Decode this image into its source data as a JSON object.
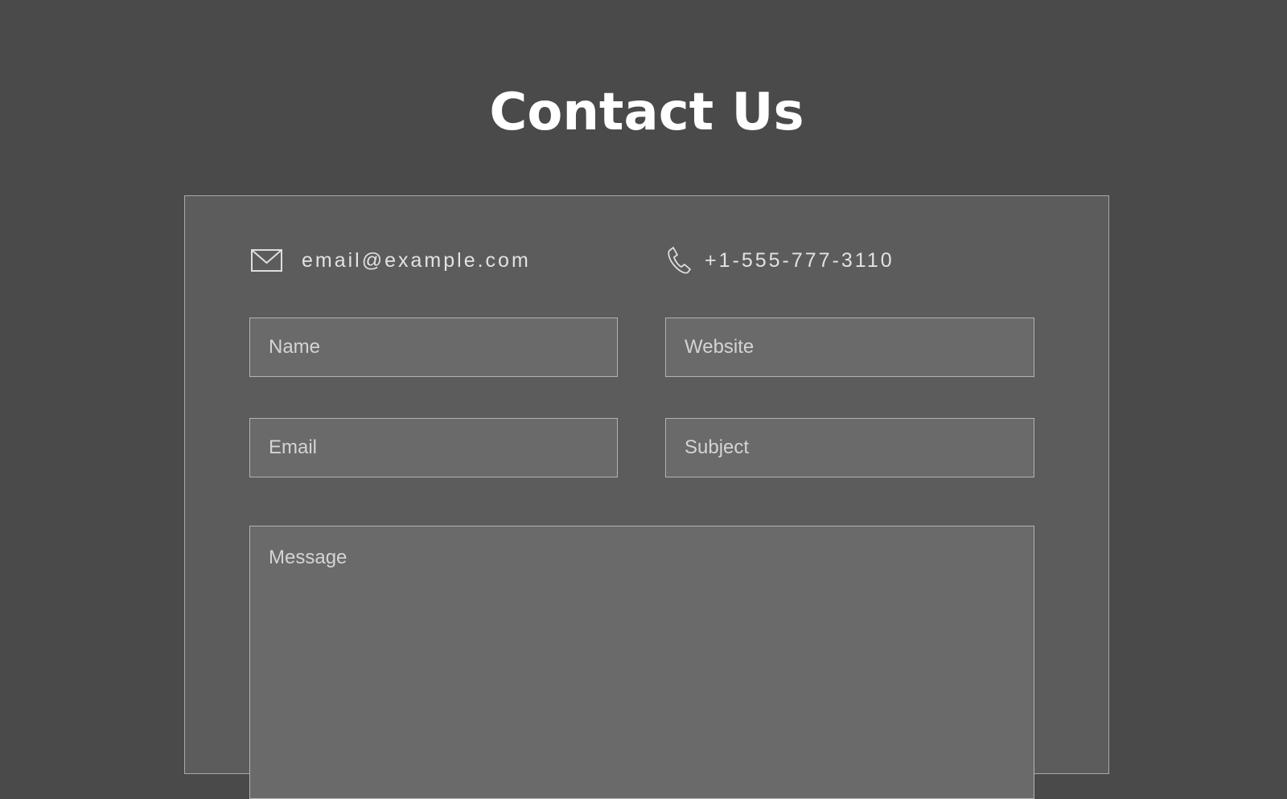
{
  "page": {
    "title": "Contact Us"
  },
  "contact": {
    "email": "email@example.com",
    "email_icon": "envelope-icon",
    "phone": "+1-555-777-3110",
    "phone_icon": "phone-icon"
  },
  "form": {
    "name_placeholder": "Name",
    "website_placeholder": "Website",
    "email_placeholder": "Email",
    "subject_placeholder": "Subject",
    "message_placeholder": "Message"
  },
  "colors": {
    "background": "#4a4a4a",
    "panel": "#5c5c5c",
    "field": "#6a6a6a",
    "border": "#b3b3b3",
    "title": "#ffffff"
  }
}
